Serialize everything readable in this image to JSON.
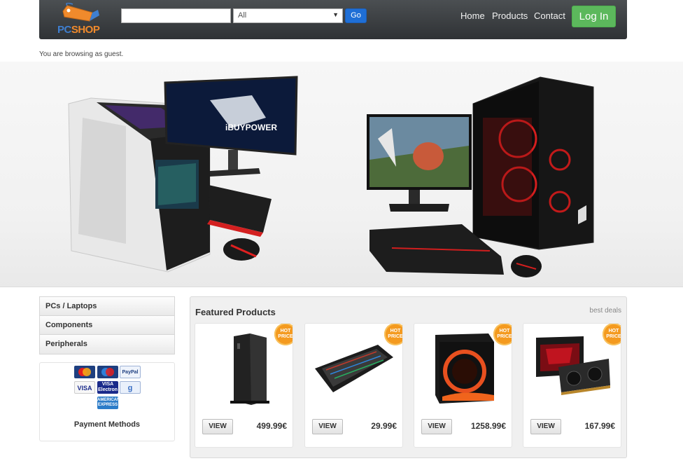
{
  "header": {
    "logo_pc": "PC",
    "logo_shop": "SHOP",
    "search": {
      "value": "",
      "placeholder": ""
    },
    "category_select": {
      "selected": "All"
    },
    "go_label": "Go",
    "nav": [
      "Home",
      "Products",
      "Contact"
    ],
    "login_label": "Log In"
  },
  "guest_notice": "You are browsing as guest.",
  "hero": {
    "left_monitor_brand": "iBUYPOWER"
  },
  "sidebar": {
    "categories": [
      "PCs / Laptops",
      "Components",
      "Peripherals"
    ],
    "payment_label": "Payment Methods",
    "payment_cards": [
      "MasterCard",
      "Maestro",
      "PayPal",
      "VISA",
      "VISA Electron",
      "Google",
      "American Express"
    ]
  },
  "featured": {
    "title": "Featured Products",
    "subtitle": "best deals",
    "badge": "HOT PRICE",
    "view_label": "VIEW",
    "products": [
      {
        "price": "499.99€",
        "icon": "pc-case"
      },
      {
        "price": "29.99€",
        "icon": "keyboard"
      },
      {
        "price": "1258.99€",
        "icon": "cpu-box"
      },
      {
        "price": "167.99€",
        "icon": "graphics-card"
      }
    ]
  },
  "colors": {
    "header_bg": "#3a3d40",
    "go_button": "#1f6fd6",
    "login_button": "#5cb85c",
    "hot_badge": "#f49a1f",
    "logo_blue": "#3f7fd0",
    "logo_orange": "#f08a2c"
  }
}
